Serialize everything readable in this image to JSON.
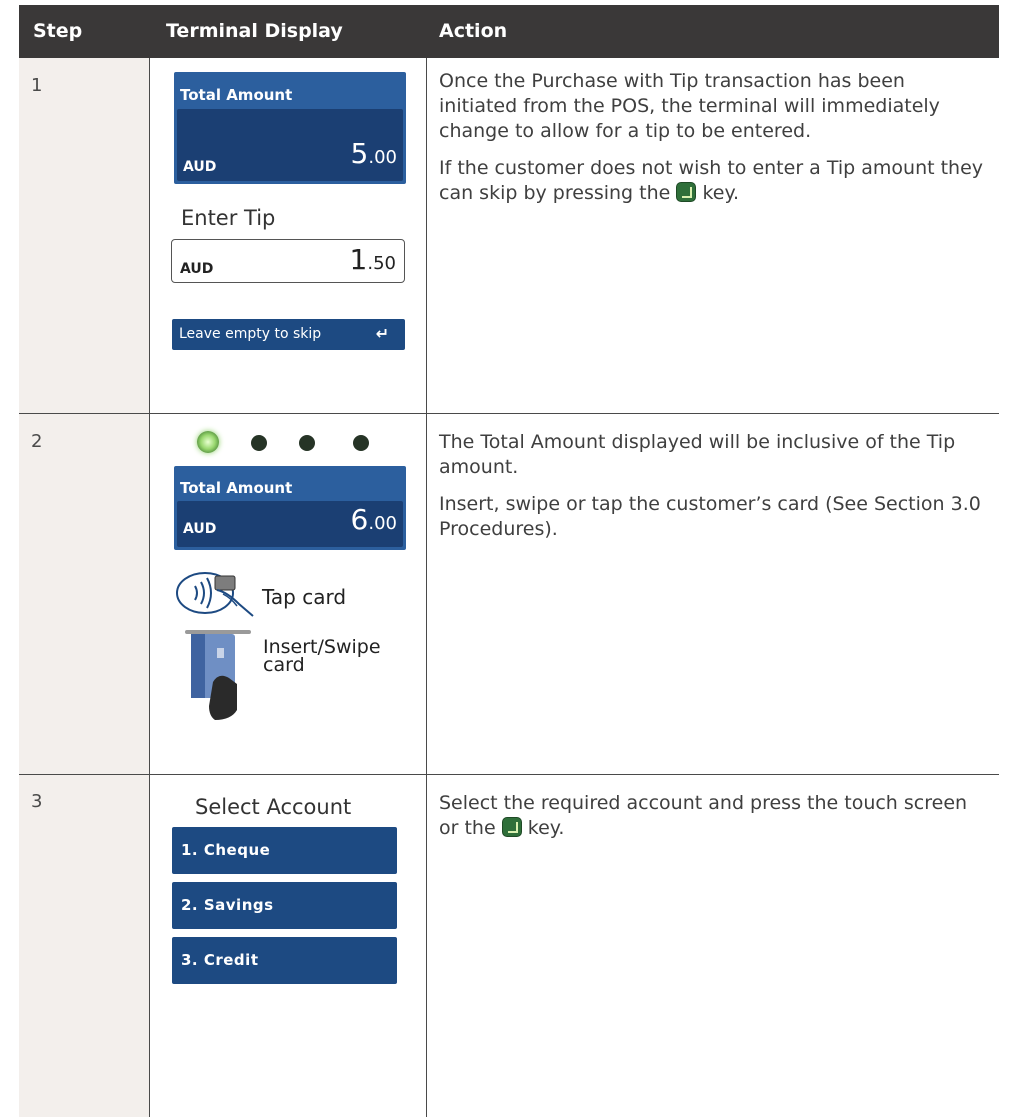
{
  "header": {
    "step": "Step",
    "terminal_display": "Terminal Display",
    "action": "Action"
  },
  "rows": [
    {
      "step": "1",
      "terminal": {
        "total_label": "Total Amount",
        "currency": "AUD",
        "amount_main": "5",
        "amount_cents": ".00",
        "enter_tip": "Enter Tip",
        "tip_currency": "AUD",
        "tip_main": "1",
        "tip_cents": ".50",
        "skip_label": "Leave empty to skip"
      },
      "action": {
        "p1": "Once the Purchase with Tip transaction has been initiated from the POS, the terminal will immediately change to allow for a tip to be entered.",
        "p2_before": "If the customer does not wish to enter a Tip amount they can skip by pressing the",
        "p2_after": "key."
      }
    },
    {
      "step": "2",
      "terminal": {
        "total_label": "Total Amount",
        "currency": "AUD",
        "amount_main": "6",
        "amount_cents": ".00",
        "tap_label": "Tap card",
        "insert_label": "Insert/Swipe card"
      },
      "action": {
        "p1": "The Total Amount displayed will be inclusive of the Tip amount.",
        "p2": "Insert, swipe or tap the customer’s card (See Section 3.0 Procedures)."
      }
    },
    {
      "step": "3",
      "terminal": {
        "select_title": "Select Account",
        "accounts": [
          "1. Cheque",
          "2. Savings",
          "3. Credit"
        ]
      },
      "action": {
        "p1_before": "Select the required account and press the touch screen or the",
        "p1_after": "key."
      }
    }
  ],
  "colors": {
    "header_bg": "#3a3838",
    "step_bg": "#f3efec",
    "screen_blue": "#1d4a82",
    "key_green": "#2f6f3a"
  },
  "icons": [
    "enter-key-icon",
    "led-indicator",
    "contactless-tap-icon",
    "card-insert-icon"
  ]
}
